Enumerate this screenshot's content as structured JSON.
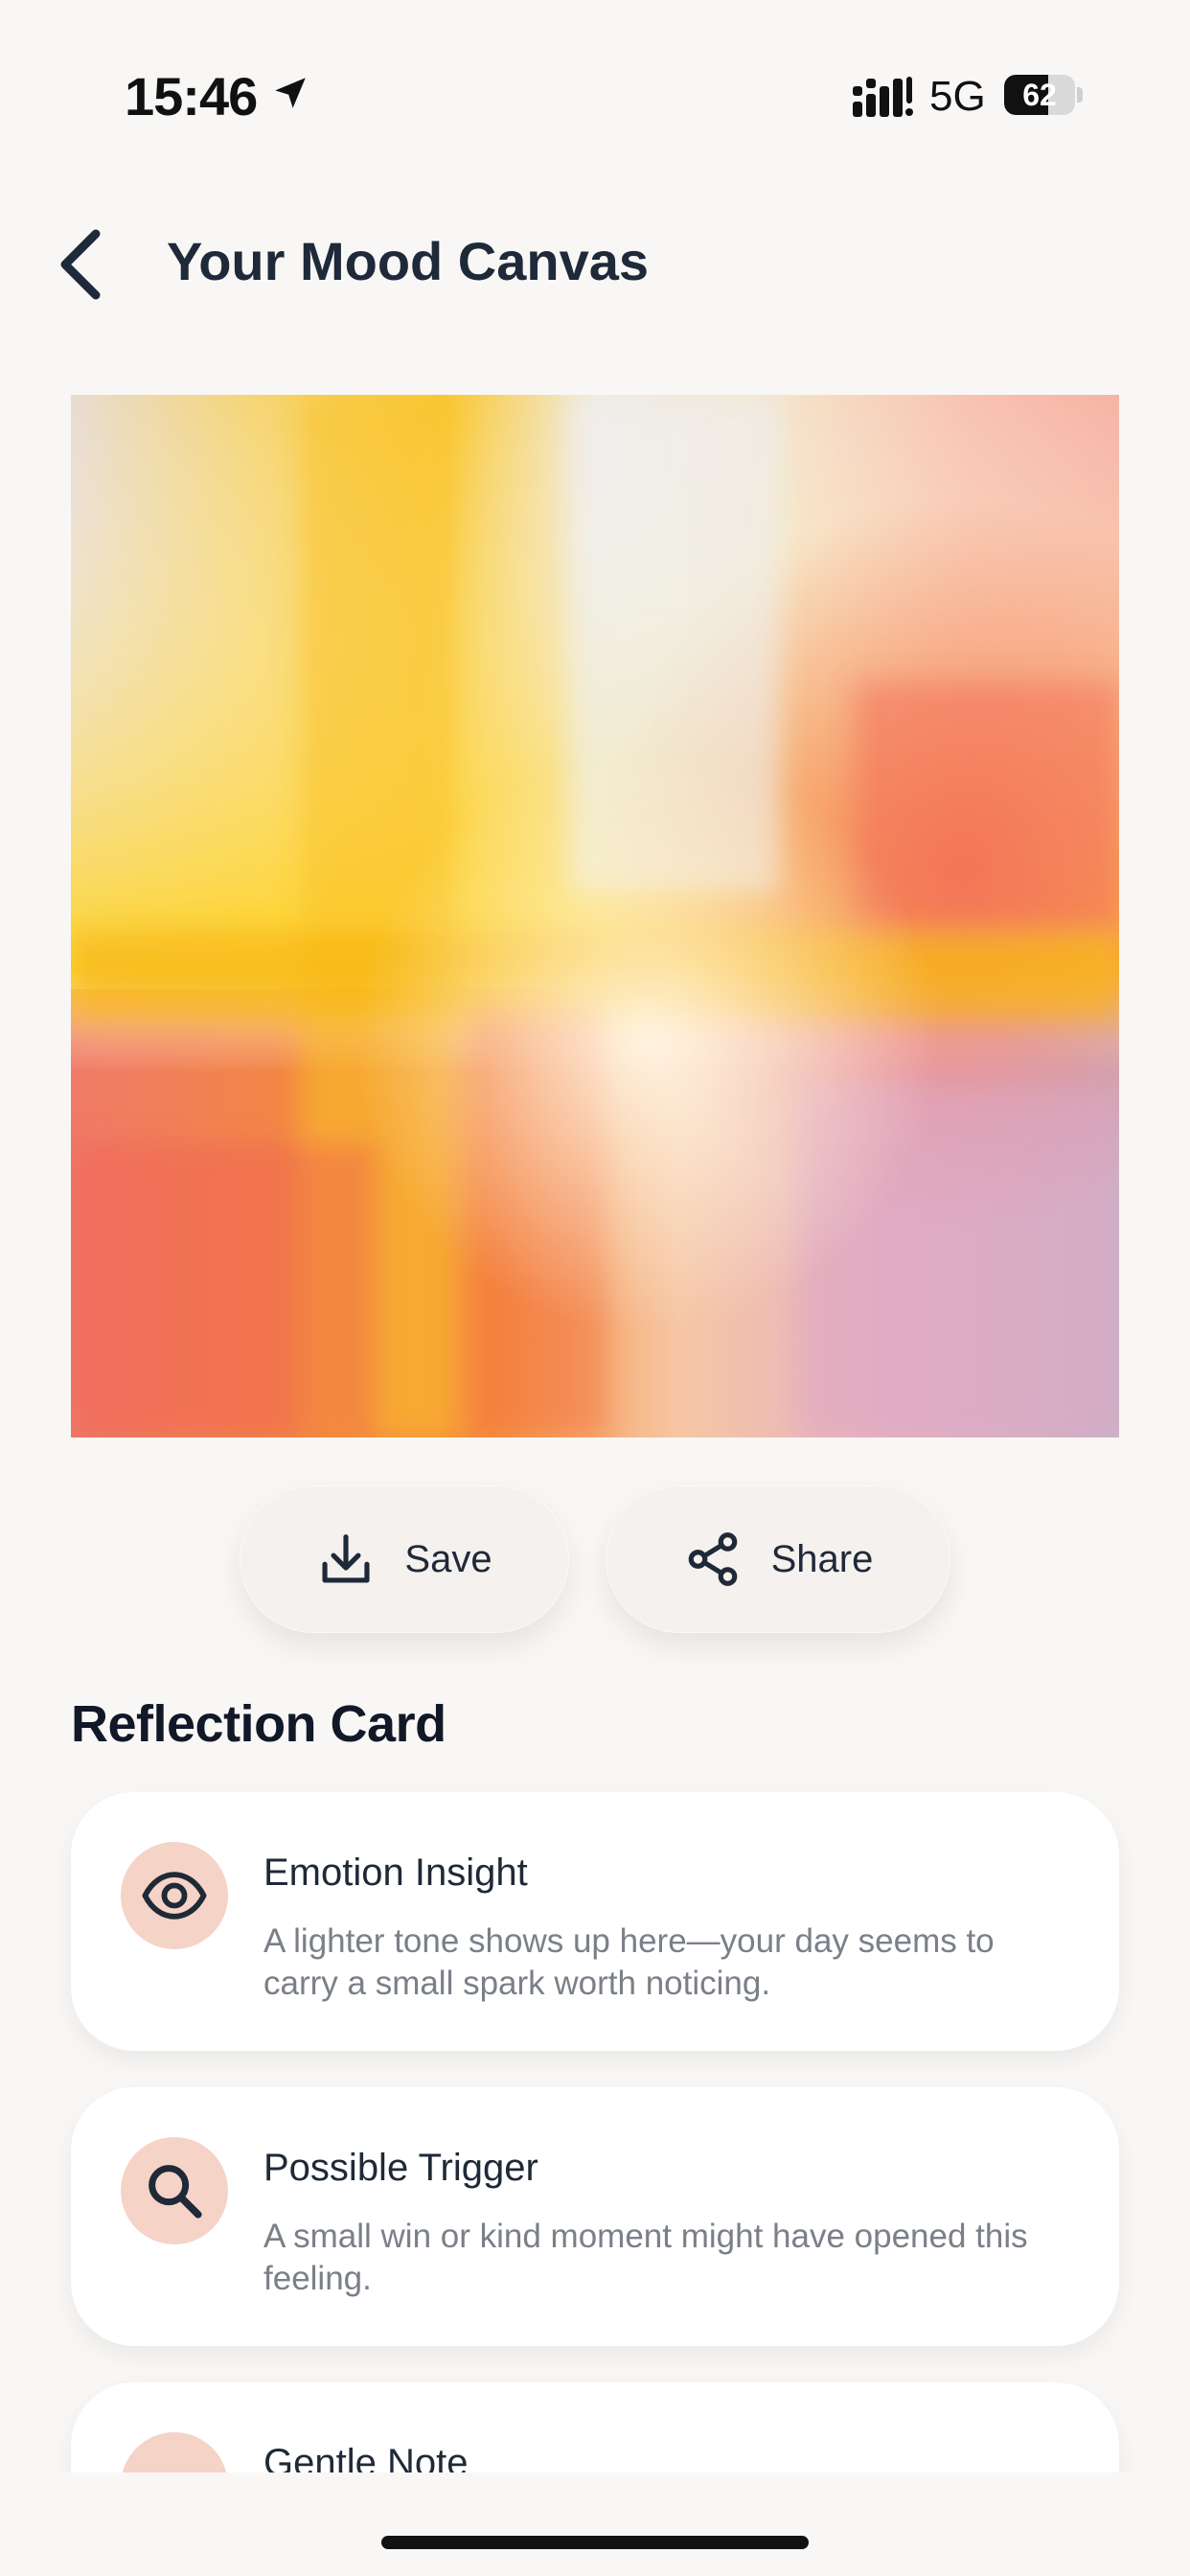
{
  "status_bar": {
    "time": "15:46",
    "network": "5G",
    "battery_percent": 62,
    "battery_label": "62"
  },
  "header": {
    "title": "Your Mood Canvas"
  },
  "actions": {
    "save_label": "Save",
    "share_label": "Share"
  },
  "reflection": {
    "section_title": "Reflection Card",
    "cards": [
      {
        "icon": "eye-icon",
        "title": "Emotion Insight",
        "body": "A lighter tone shows up here—your day seems to carry a small spark worth noticing."
      },
      {
        "icon": "search-icon",
        "title": "Possible Trigger",
        "body": "A small win or kind moment might have opened this feeling."
      },
      {
        "icon": "dot-icon",
        "title": "Gentle Note",
        "body": ""
      }
    ]
  },
  "colors": {
    "background": "#f9f7f5",
    "icon_circle": "#f5d3c7",
    "text_primary": "#1f2937",
    "text_secondary": "#7a7f88"
  }
}
